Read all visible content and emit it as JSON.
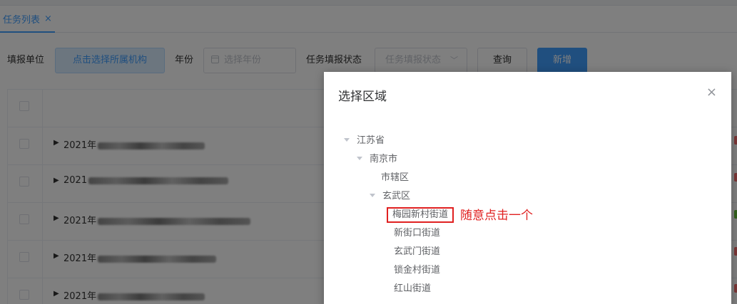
{
  "tabs": [
    {
      "label": "任务列表",
      "close": "×"
    }
  ],
  "filters": {
    "unit_label": "填报单位",
    "org_button": "点击选择所属机构",
    "year_label": "年份",
    "year_placeholder": "选择年份",
    "status_label": "任务填报状态",
    "status_placeholder": "任务填报状态",
    "query_button": "查询",
    "add_button": "新增"
  },
  "table": {
    "rows": [
      {
        "prefix": "2021年"
      },
      {
        "prefix": "2021"
      },
      {
        "prefix": "2021年"
      },
      {
        "prefix": "2021年"
      },
      {
        "prefix": "2021年"
      }
    ]
  },
  "dialog": {
    "title": "选择区域",
    "close": "×",
    "tree": [
      {
        "label": "江苏省",
        "level": 0,
        "expanded": true
      },
      {
        "label": "南京市",
        "level": 1,
        "expanded": true
      },
      {
        "label": "市辖区",
        "level": 2,
        "expanded": false
      },
      {
        "label": "玄武区",
        "level": 2,
        "expanded": true
      },
      {
        "label": "梅园新村街道",
        "level": 3,
        "expanded": false,
        "highlighted": true
      },
      {
        "label": "新街口街道",
        "level": 3,
        "expanded": false
      },
      {
        "label": "玄武门街道",
        "level": 3,
        "expanded": false
      },
      {
        "label": "锁金村街道",
        "level": 3,
        "expanded": false
      },
      {
        "label": "红山街道",
        "level": 3,
        "expanded": false
      }
    ]
  },
  "annotation": "随意点击一个",
  "colors": {
    "primary": "#409eff",
    "annotation": "#e02020",
    "edge_red": "#f56c6c",
    "edge_green": "#67c23a"
  }
}
